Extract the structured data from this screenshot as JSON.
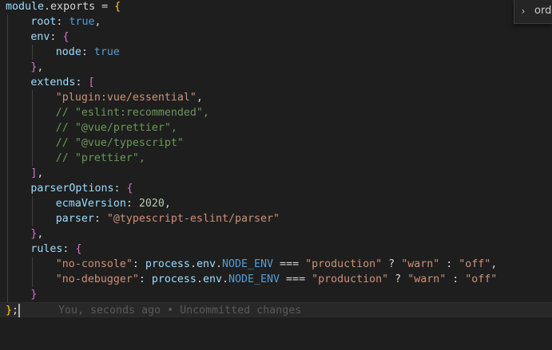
{
  "editor": {
    "lines": [
      {
        "indent": 0,
        "tokens": [
          {
            "t": "module",
            "c": "var"
          },
          {
            "t": ".exports = ",
            "c": "plain"
          },
          {
            "t": "{",
            "c": "b1"
          }
        ]
      },
      {
        "indent": 1,
        "tokens": [
          {
            "t": "root",
            "c": "var"
          },
          {
            "t": ": ",
            "c": "plain"
          },
          {
            "t": "true",
            "c": "kw"
          },
          {
            "t": ",",
            "c": "plain"
          }
        ]
      },
      {
        "indent": 1,
        "tokens": [
          {
            "t": "env",
            "c": "var"
          },
          {
            "t": ": ",
            "c": "plain"
          },
          {
            "t": "{",
            "c": "b2"
          }
        ]
      },
      {
        "indent": 2,
        "tokens": [
          {
            "t": "node",
            "c": "var"
          },
          {
            "t": ": ",
            "c": "plain"
          },
          {
            "t": "true",
            "c": "kw"
          }
        ]
      },
      {
        "indent": 1,
        "tokens": [
          {
            "t": "}",
            "c": "b2"
          },
          {
            "t": ",",
            "c": "plain"
          }
        ]
      },
      {
        "indent": 1,
        "tokens": [
          {
            "t": "extends",
            "c": "var"
          },
          {
            "t": ": ",
            "c": "plain"
          },
          {
            "t": "[",
            "c": "b2"
          }
        ]
      },
      {
        "indent": 2,
        "tokens": [
          {
            "t": "\"plugin:vue/essential\"",
            "c": "str"
          },
          {
            "t": ",",
            "c": "plain"
          }
        ]
      },
      {
        "indent": 2,
        "tokens": [
          {
            "t": "// \"eslint:recommended\",",
            "c": "com"
          }
        ]
      },
      {
        "indent": 2,
        "tokens": [
          {
            "t": "// \"@vue/prettier\",",
            "c": "com"
          }
        ]
      },
      {
        "indent": 2,
        "tokens": [
          {
            "t": "// \"@vue/typescript\"",
            "c": "com"
          }
        ]
      },
      {
        "indent": 2,
        "tokens": [
          {
            "t": "// \"prettier\",",
            "c": "com"
          }
        ]
      },
      {
        "indent": 1,
        "tokens": [
          {
            "t": "]",
            "c": "b2"
          },
          {
            "t": ",",
            "c": "plain"
          }
        ]
      },
      {
        "indent": 1,
        "tokens": [
          {
            "t": "parserOptions",
            "c": "var"
          },
          {
            "t": ": ",
            "c": "plain"
          },
          {
            "t": "{",
            "c": "b2"
          }
        ]
      },
      {
        "indent": 2,
        "tokens": [
          {
            "t": "ecmaVersion",
            "c": "var"
          },
          {
            "t": ": ",
            "c": "plain"
          },
          {
            "t": "2020",
            "c": "num"
          },
          {
            "t": ",",
            "c": "plain"
          }
        ]
      },
      {
        "indent": 2,
        "tokens": [
          {
            "t": "parser",
            "c": "var"
          },
          {
            "t": ": ",
            "c": "plain"
          },
          {
            "t": "\"@typescript-eslint/parser\"",
            "c": "str"
          }
        ]
      },
      {
        "indent": 1,
        "tokens": [
          {
            "t": "}",
            "c": "b2"
          },
          {
            "t": ",",
            "c": "plain"
          }
        ]
      },
      {
        "indent": 1,
        "tokens": [
          {
            "t": "rules",
            "c": "var"
          },
          {
            "t": ": ",
            "c": "plain"
          },
          {
            "t": "{",
            "c": "b2"
          }
        ]
      },
      {
        "indent": 2,
        "tokens": [
          {
            "t": "\"no-console\"",
            "c": "str"
          },
          {
            "t": ": ",
            "c": "plain"
          },
          {
            "t": "process",
            "c": "var"
          },
          {
            "t": ".",
            "c": "plain"
          },
          {
            "t": "env",
            "c": "var"
          },
          {
            "t": ".",
            "c": "plain"
          },
          {
            "t": "NODE_ENV",
            "c": "kw"
          },
          {
            "t": " === ",
            "c": "plain"
          },
          {
            "t": "\"production\"",
            "c": "str"
          },
          {
            "t": " ? ",
            "c": "plain"
          },
          {
            "t": "\"warn\"",
            "c": "str"
          },
          {
            "t": " : ",
            "c": "plain"
          },
          {
            "t": "\"off\"",
            "c": "str"
          },
          {
            "t": ",",
            "c": "plain"
          }
        ]
      },
      {
        "indent": 2,
        "tokens": [
          {
            "t": "\"no-debugger\"",
            "c": "str"
          },
          {
            "t": ": ",
            "c": "plain"
          },
          {
            "t": "process",
            "c": "var"
          },
          {
            "t": ".",
            "c": "plain"
          },
          {
            "t": "env",
            "c": "var"
          },
          {
            "t": ".",
            "c": "plain"
          },
          {
            "t": "NODE_ENV",
            "c": "kw"
          },
          {
            "t": " === ",
            "c": "plain"
          },
          {
            "t": "\"production\"",
            "c": "str"
          },
          {
            "t": " ? ",
            "c": "plain"
          },
          {
            "t": "\"warn\"",
            "c": "str"
          },
          {
            "t": " : ",
            "c": "plain"
          },
          {
            "t": "\"off\"",
            "c": "str"
          }
        ]
      },
      {
        "indent": 1,
        "tokens": [
          {
            "t": "}",
            "c": "b2"
          }
        ]
      },
      {
        "indent": 0,
        "current": true,
        "tokens": [
          {
            "t": "}",
            "c": "b1"
          },
          {
            "t": ";",
            "c": "plain"
          }
        ],
        "blame": "You, seconds ago • Uncommitted changes"
      }
    ]
  },
  "find_widget": {
    "toggle_icon": "chevron-right-icon",
    "toggle_glyph": "›",
    "input_text": "orde"
  },
  "colors": {
    "background": "#1e1e1e",
    "variable": "#9cdcfe",
    "keyword": "#569cd6",
    "string": "#ce9178",
    "number": "#b5cea8",
    "comment": "#6a9955",
    "bracket_level1": "#ffd700",
    "bracket_level2": "#da70d6"
  }
}
